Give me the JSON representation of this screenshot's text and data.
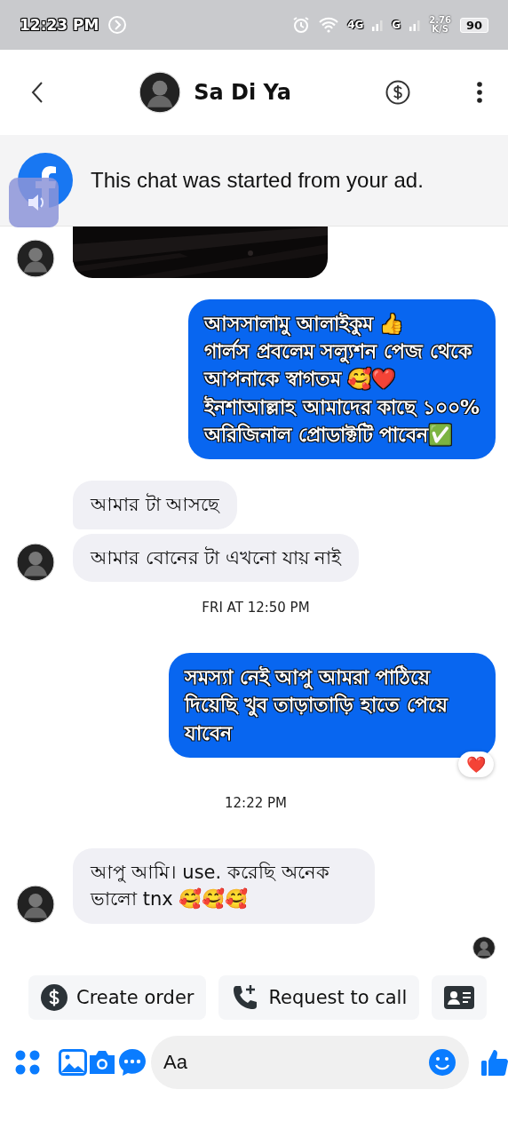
{
  "status_bar": {
    "time": "12:23 PM",
    "network_4g": "4G",
    "network_g": "G",
    "speed": "2.76",
    "speed_unit": "K/S",
    "battery": "90"
  },
  "header": {
    "name": "Sa Di Ya"
  },
  "banner": {
    "text": "This chat was started from your ad."
  },
  "messages": [
    {
      "kind": "picture",
      "avatar": true
    },
    {
      "kind": "outgoing",
      "text": "আসসালামু আলাইকুম 👍\nগার্লস প্রবলেম সল্যুশন পেজ থেকে\nআপনাকে স্বাগতম 🥰❤️\nইনশাআল্লাহ আমাদের কাছে ১০০%\nঅরিজিনাল প্রোডাক্টটি পাবেন✅"
    },
    {
      "kind": "incoming",
      "text": "আমার টা আসছে",
      "avatar": false
    },
    {
      "kind": "incoming",
      "text": "আমার বোনের টা এখনো যায় নাই",
      "avatar": true
    },
    {
      "kind": "timestamp",
      "text": "FRI AT 12:50 PM"
    },
    {
      "kind": "outgoing",
      "text": "সমস্যা নেই আপু আমরা পাঠিয়ে দিয়েছি খুব তাড়াতাড়ি হাতে পেয়ে যাবেন",
      "reaction": "❤️"
    },
    {
      "kind": "timestamp",
      "text": "12:22 PM"
    },
    {
      "kind": "incoming",
      "text": "আপু আমি। use. করেছি অনেক ভালো tnx 🥰🥰🥰",
      "avatar": true
    },
    {
      "kind": "seen"
    }
  ],
  "quick_replies": [
    {
      "kind": "order",
      "label": "Create order"
    },
    {
      "kind": "call",
      "label": "Request to call"
    },
    {
      "kind": "contact"
    }
  ],
  "composer": {
    "placeholder": "Aa"
  }
}
